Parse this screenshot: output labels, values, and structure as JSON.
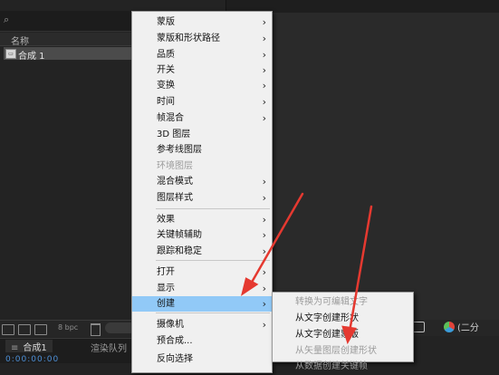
{
  "project_panel": {
    "column_name": "名称",
    "comp_item": "合成 1"
  },
  "bottom_toolbar": {
    "bpc": "8 bpc",
    "view_select": "(二分"
  },
  "timeline": {
    "comp_tab": "合成1",
    "close": "≡",
    "render_tab": "渲染队列",
    "timecode": "0:00:00:00"
  },
  "context_menu": {
    "items": [
      {
        "label": "蒙版",
        "submenu": true,
        "enabled": true
      },
      {
        "label": "蒙版和形状路径",
        "submenu": true,
        "enabled": true
      },
      {
        "label": "品质",
        "submenu": true,
        "enabled": true
      },
      {
        "label": "开关",
        "submenu": true,
        "enabled": true
      },
      {
        "label": "变换",
        "submenu": true,
        "enabled": true
      },
      {
        "label": "时间",
        "submenu": true,
        "enabled": true
      },
      {
        "label": "帧混合",
        "submenu": true,
        "enabled": true
      },
      {
        "label": "3D 图层",
        "submenu": false,
        "enabled": true
      },
      {
        "label": "参考线图层",
        "submenu": false,
        "enabled": true
      },
      {
        "label": "环境图层",
        "submenu": false,
        "enabled": false
      },
      {
        "label": "混合模式",
        "submenu": true,
        "enabled": true
      },
      {
        "label": "图层样式",
        "submenu": true,
        "enabled": true
      },
      {
        "label": "效果",
        "submenu": true,
        "enabled": true
      },
      {
        "label": "关键帧辅助",
        "submenu": true,
        "enabled": true
      },
      {
        "label": "跟踪和稳定",
        "submenu": true,
        "enabled": true
      },
      {
        "label": "打开",
        "submenu": true,
        "enabled": true
      },
      {
        "label": "显示",
        "submenu": true,
        "enabled": true
      },
      {
        "label": "创建",
        "submenu": true,
        "enabled": true,
        "highlighted": true
      },
      {
        "label": "摄像机",
        "submenu": true,
        "enabled": true
      },
      {
        "label": "预合成...",
        "submenu": false,
        "enabled": true
      },
      {
        "label": "反向选择",
        "submenu": false,
        "enabled": true
      }
    ]
  },
  "submenu": {
    "items": [
      {
        "label": "转换为可编辑文字",
        "enabled": false
      },
      {
        "label": "从文字创建形状",
        "enabled": true
      },
      {
        "label": "从文字创建蒙版",
        "enabled": true
      },
      {
        "label": "从矢量图层创建形状",
        "enabled": false
      },
      {
        "label": "从数据创建关键帧",
        "enabled": false
      }
    ]
  },
  "colors": {
    "menu_bg": "#f0f0f0",
    "highlight": "#91c9f7",
    "annotation": "#e53930",
    "timecode": "#4d8fd6"
  }
}
